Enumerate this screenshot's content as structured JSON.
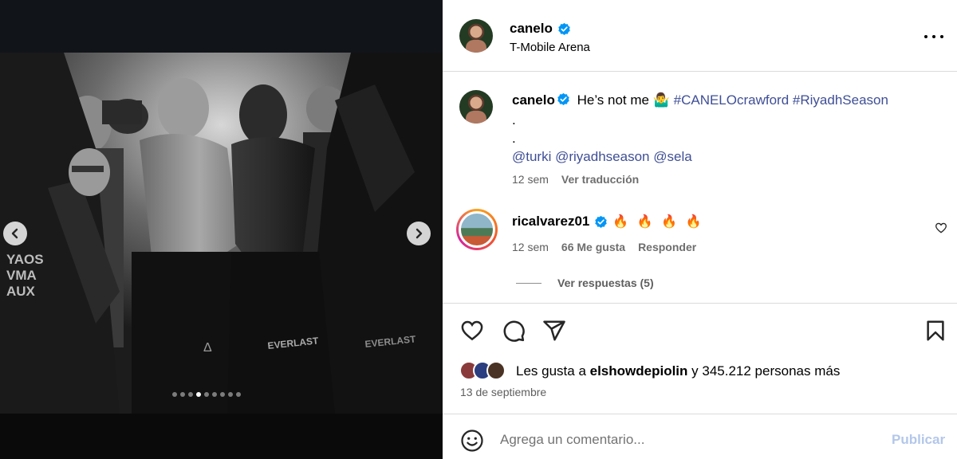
{
  "post": {
    "username": "canelo",
    "location": "T-Mobile Arena",
    "caption_text": "He’s not me 🤷‍♂️",
    "hashtags": [
      "#CANELOcrawford",
      "#RiyadhSeason"
    ],
    "dot1": ".",
    "dot2": ".",
    "mentions": [
      "@turki",
      "@riyadhseason",
      "@sela"
    ],
    "caption_time": "12 sem",
    "translate_label": "Ver traducción"
  },
  "media": {
    "slide_count": 9,
    "active_slide": 4
  },
  "comment": {
    "username": "ricalvarez01",
    "text": "🔥 🔥 🔥 🔥",
    "time": "12 sem",
    "likes": "66 Me gusta",
    "reply_label": "Responder",
    "view_replies": "Ver respuestas (5)"
  },
  "likes": {
    "prefix": "Les gusta a ",
    "user": "elshowdepiolin",
    "suffix": " y 345.212 personas más"
  },
  "date": "13 de septiembre",
  "comment_box": {
    "placeholder": "Agrega un comentario...",
    "publish_label": "Publicar"
  },
  "icons": {
    "verified": "verified-badge-icon",
    "more": "more-options-icon",
    "like": "heart-icon",
    "comment": "comment-bubble-icon",
    "share": "paper-plane-icon",
    "save": "bookmark-icon",
    "emoji": "emoji-smiley-icon",
    "prev": "chevron-left-icon",
    "next": "chevron-right-icon"
  },
  "colors": {
    "verified": "#0095f6",
    "link": "#3f4f96",
    "publish_disabled": "#b3c7ea"
  }
}
